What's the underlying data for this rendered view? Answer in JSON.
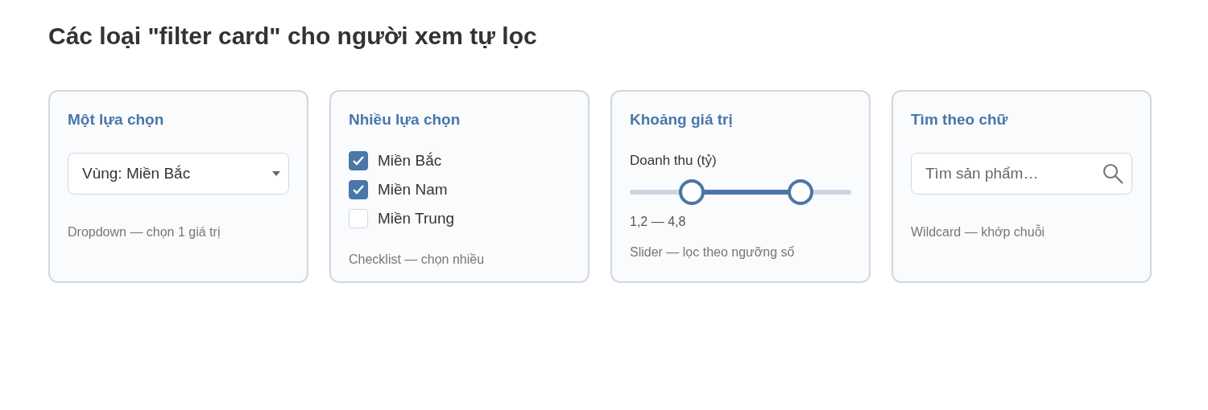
{
  "title": "Các loại \"filter card\" cho người xem tự lọc",
  "cards": [
    {
      "kind": "dropdown",
      "title": "Một lựa chọn",
      "value": "Vùng: Miền Bắc",
      "note": "Dropdown — chọn 1 giá trị"
    },
    {
      "kind": "checklist",
      "title": "Nhiều lựa chọn",
      "options": [
        {
          "label": "Miền Bắc",
          "checked": true
        },
        {
          "label": "Miền Nam",
          "checked": true
        },
        {
          "label": "Miền Trung",
          "checked": false
        }
      ],
      "note": "Checklist — chọn nhiều"
    },
    {
      "kind": "slider",
      "title": "Khoảng giá trị",
      "label": "Doanh thu (tỷ)",
      "from": {
        "level": 0.28
      },
      "to": {
        "level": 0.77
      },
      "reading": "1,2 — 4,8",
      "note": "Slider — lọc theo ngưỡng số"
    },
    {
      "kind": "search",
      "title": "Tìm theo chữ",
      "placeholder": "Tìm sản phẩm…",
      "note": "Wildcard — khớp chuỗi"
    }
  ]
}
